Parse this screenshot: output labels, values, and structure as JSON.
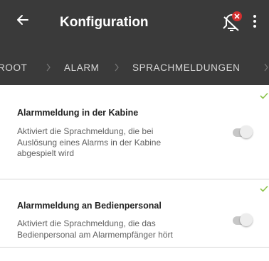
{
  "header": {
    "title": "Konfiguration",
    "back_icon": "arrow-left-icon",
    "alarm_icon": "alarm-off-icon",
    "menu_icon": "more-vertical-icon"
  },
  "breadcrumb": {
    "items": [
      "ROOT",
      "ALARM",
      "SPRACHMELDUNGEN"
    ]
  },
  "settings": [
    {
      "title": "Alarmmeldung in der Kabine",
      "description": "Aktiviert die Sprachmeldung, die bei Auslösung eines Alarms in der Kabine abgespielt wird",
      "enabled": false,
      "saved": true
    },
    {
      "title": "Alarmmeldung an Bedienpersonal",
      "description": "Aktiviert die Sprachmeldung, die das Bedienpersonal am Alarmempfänger hört",
      "enabled": false,
      "saved": true
    }
  ],
  "colors": {
    "appbar": "#3a3a3a",
    "check": "#8bc34a",
    "badge": "#d32f2f"
  }
}
